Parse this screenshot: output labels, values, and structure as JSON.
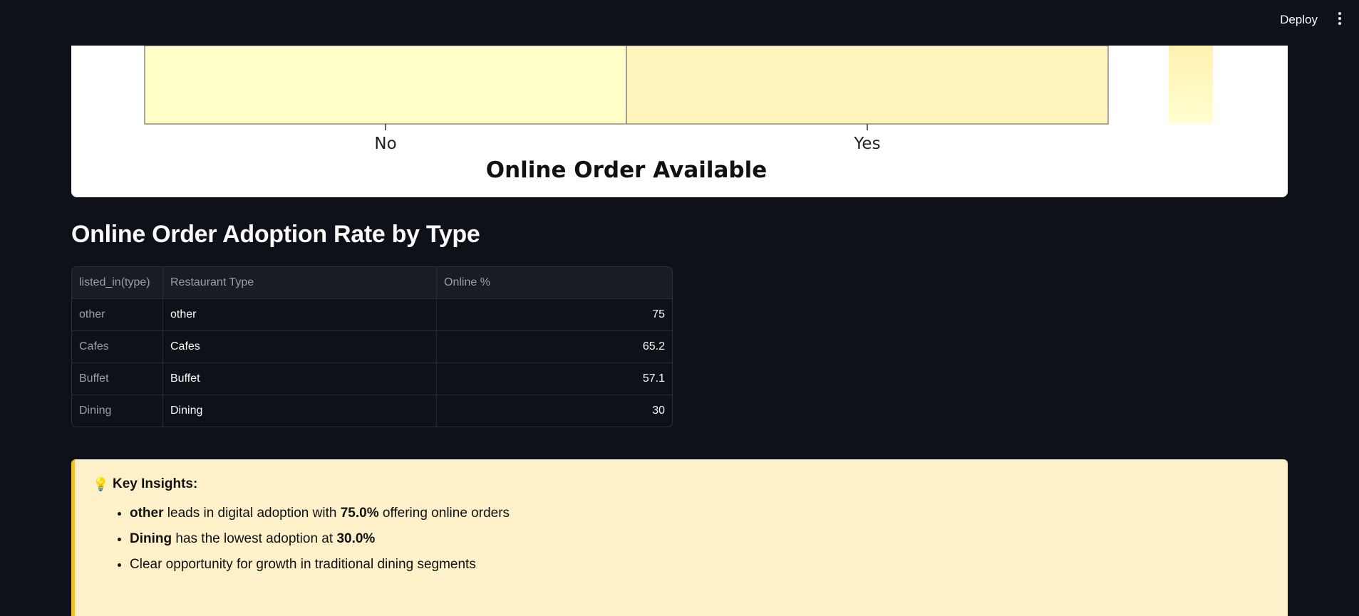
{
  "header": {
    "deploy_label": "Deploy",
    "menu_icon": "more-vertical-icon"
  },
  "chart_data": {
    "type": "heatmap",
    "categories": [
      "No",
      "Yes"
    ],
    "xlabel": "Online Order Available",
    "colors": {
      "no_cell": "#ffffc8",
      "yes_cell": "#fff5bc",
      "colorbar_top": "#fff0b0",
      "colorbar_bottom": "#ffffd0"
    }
  },
  "section": {
    "title": "Online Order Adoption Rate by Type"
  },
  "table": {
    "columns": [
      "listed_in(type)",
      "Restaurant Type",
      "Online %"
    ],
    "rows": [
      {
        "index": "other",
        "type": "other",
        "online": "75"
      },
      {
        "index": "Cafes",
        "type": "Cafes",
        "online": "65.2"
      },
      {
        "index": "Buffet",
        "type": "Buffet",
        "online": "57.1"
      },
      {
        "index": "Dining",
        "type": "Dining",
        "online": "30"
      }
    ]
  },
  "insights": {
    "icon": "lightbulb-icon",
    "title": "Key Insights:",
    "items": [
      {
        "bold1": "other",
        "text1": " leads in digital adoption with ",
        "bold2": "75.0%",
        "text2": " offering online orders"
      },
      {
        "bold1": "Dining",
        "text1": " has the lowest adoption at ",
        "bold2": "30.0%",
        "text2": ""
      },
      {
        "bold1": "",
        "text1": "Clear opportunity for growth in traditional dining segments",
        "bold2": "",
        "text2": ""
      }
    ]
  }
}
